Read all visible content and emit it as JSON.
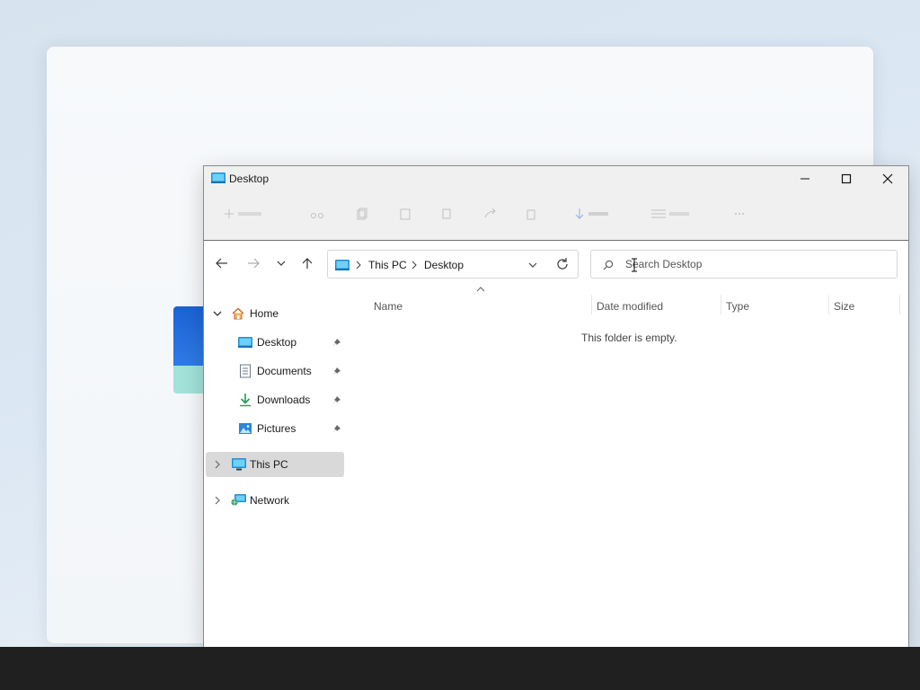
{
  "window": {
    "title": "Desktop",
    "controls": {
      "minimize": "minimize",
      "maximize": "maximize",
      "close": "close"
    }
  },
  "address": {
    "crumbs": [
      "This PC",
      "Desktop"
    ]
  },
  "search": {
    "placeholder": "Search Desktop",
    "value": ""
  },
  "sidebar": {
    "home": {
      "label": "Home",
      "expanded": true
    },
    "quick_access": [
      {
        "label": "Desktop",
        "icon": "desktop-folder-icon",
        "pinned": true
      },
      {
        "label": "Documents",
        "icon": "documents-icon",
        "pinned": true
      },
      {
        "label": "Downloads",
        "icon": "downloads-icon",
        "pinned": true
      },
      {
        "label": "Pictures",
        "icon": "pictures-icon",
        "pinned": true
      }
    ],
    "this_pc": {
      "label": "This PC",
      "selected": true
    },
    "network": {
      "label": "Network"
    }
  },
  "columns": {
    "name": "Name",
    "date_modified": "Date modified",
    "type": "Type",
    "size": "Size"
  },
  "content": {
    "empty_message": "This folder is empty."
  },
  "colors": {
    "accent": "#1a63d6",
    "selection": "#d9d9d9",
    "taskbar": "#202020"
  }
}
